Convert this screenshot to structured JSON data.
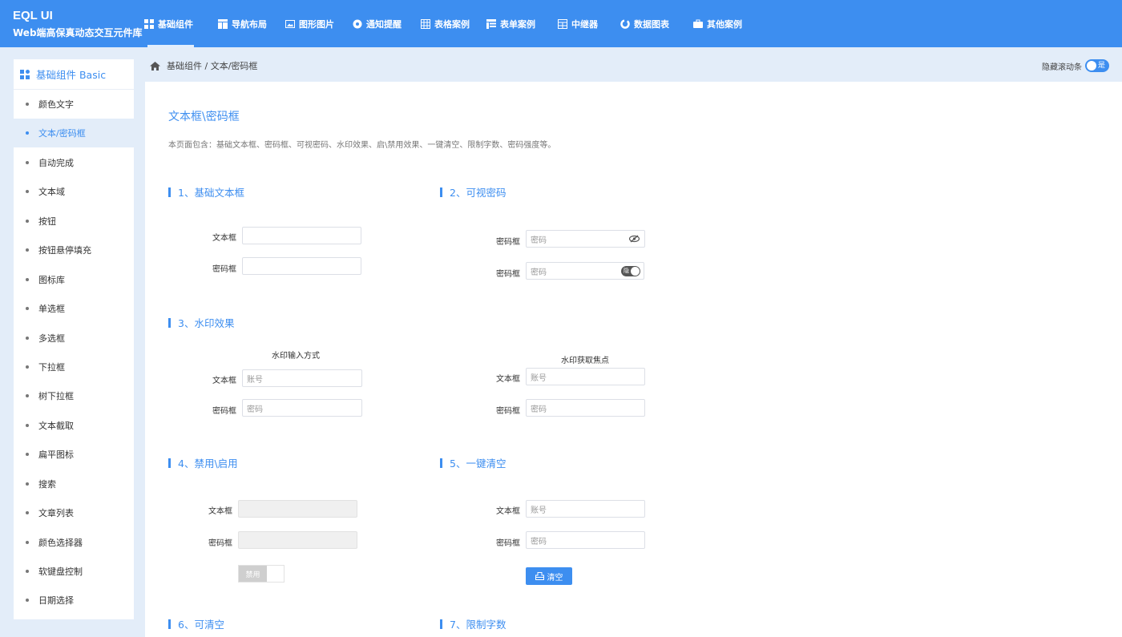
{
  "brand": {
    "title": "EQL UI",
    "subtitle": "Web端高保真动态交互元件库"
  },
  "nav": [
    {
      "label": "基础组件",
      "icon": "grid-icon"
    },
    {
      "label": "导航布局",
      "icon": "layout-icon"
    },
    {
      "label": "图形图片",
      "icon": "image-icon"
    },
    {
      "label": "通知提醒",
      "icon": "bell-icon"
    },
    {
      "label": "表格案例",
      "icon": "table-icon"
    },
    {
      "label": "表单案例",
      "icon": "form-icon"
    },
    {
      "label": "中继器",
      "icon": "repeater-icon"
    },
    {
      "label": "数据图表",
      "icon": "chart-icon"
    },
    {
      "label": "其他案例",
      "icon": "briefcase-icon"
    }
  ],
  "sidebar": {
    "header": "基础组件 Basic",
    "items": [
      {
        "label": "颜色文字"
      },
      {
        "label": "文本/密码框"
      },
      {
        "label": "自动完成"
      },
      {
        "label": "文本域"
      },
      {
        "label": "按钮"
      },
      {
        "label": "按钮悬停填充"
      },
      {
        "label": "图标库"
      },
      {
        "label": "单选框"
      },
      {
        "label": "多选框"
      },
      {
        "label": "下拉框"
      },
      {
        "label": "树下拉框"
      },
      {
        "label": "文本截取"
      },
      {
        "label": "扁平图标"
      },
      {
        "label": "搜索"
      },
      {
        "label": "文章列表"
      },
      {
        "label": "颜色选择器"
      },
      {
        "label": "软键盘控制"
      },
      {
        "label": "日期选择"
      }
    ]
  },
  "breadcrumb": "基础组件 / 文本/密码框",
  "scroll_toggle": {
    "label": "隐藏滚动条",
    "state": "是"
  },
  "page": {
    "title": "文本框\\密码框",
    "desc": "本页面包含：基础文本框、密码框、可视密码、水印效果、启\\禁用效果、一键清空、限制字数、密码强度等。"
  },
  "sections": {
    "s1": {
      "title": "1、基础文本框",
      "text_label": "文本框",
      "pwd_label": "密码框"
    },
    "s2": {
      "title": "2、可视密码",
      "pwd_label1": "密码框",
      "pwd_label2": "密码框",
      "placeholder1": "密码",
      "placeholder2": "密码",
      "toggle_text": "隐"
    },
    "s3": {
      "title": "3、水印效果",
      "sub_left": "水印输入方式",
      "sub_right": "水印获取焦点",
      "text_label": "文本框",
      "pwd_label": "密码框",
      "ph_account": "账号",
      "ph_pwd": "密码"
    },
    "s4": {
      "title": "4、禁用\\启用",
      "text_label": "文本框",
      "pwd_label": "密码框",
      "switch_label": "禁用"
    },
    "s5": {
      "title": "5、一键清空",
      "text_label": "文本框",
      "pwd_label": "密码框",
      "ph_account": "账号",
      "ph_pwd": "密码",
      "button": "清空"
    },
    "s6": {
      "title": "6、可清空"
    },
    "s7": {
      "title": "7、限制字数"
    }
  },
  "colors": {
    "accent": "#3d8ef0",
    "bg": "#e3edf9"
  }
}
